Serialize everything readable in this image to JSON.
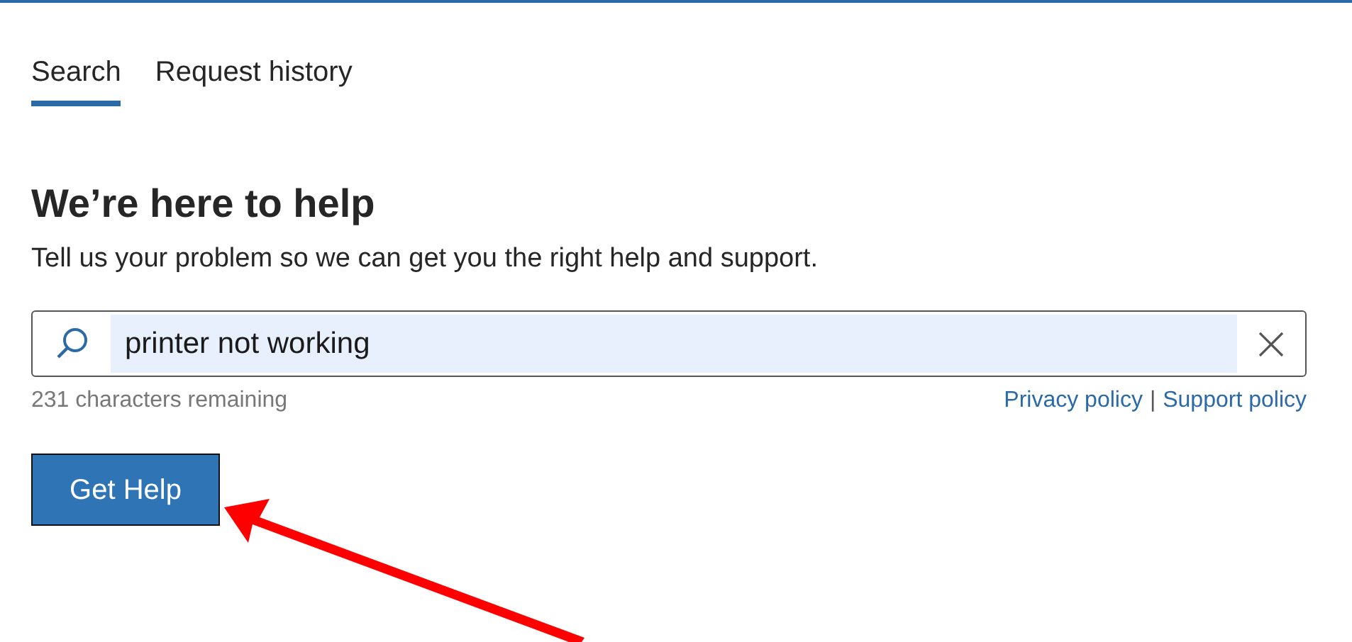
{
  "tabs": [
    {
      "label": "Search",
      "selected": true
    },
    {
      "label": "Request history",
      "selected": false
    }
  ],
  "heading": "We’re here to help",
  "subtitle": "Tell us your problem so we can get you the right help and support.",
  "search": {
    "value": "printer not working",
    "highlighted": true
  },
  "remaining": "231 characters remaining",
  "links": [
    "Privacy policy",
    "Support policy"
  ],
  "links_separator": "|",
  "button": "Get Help"
}
